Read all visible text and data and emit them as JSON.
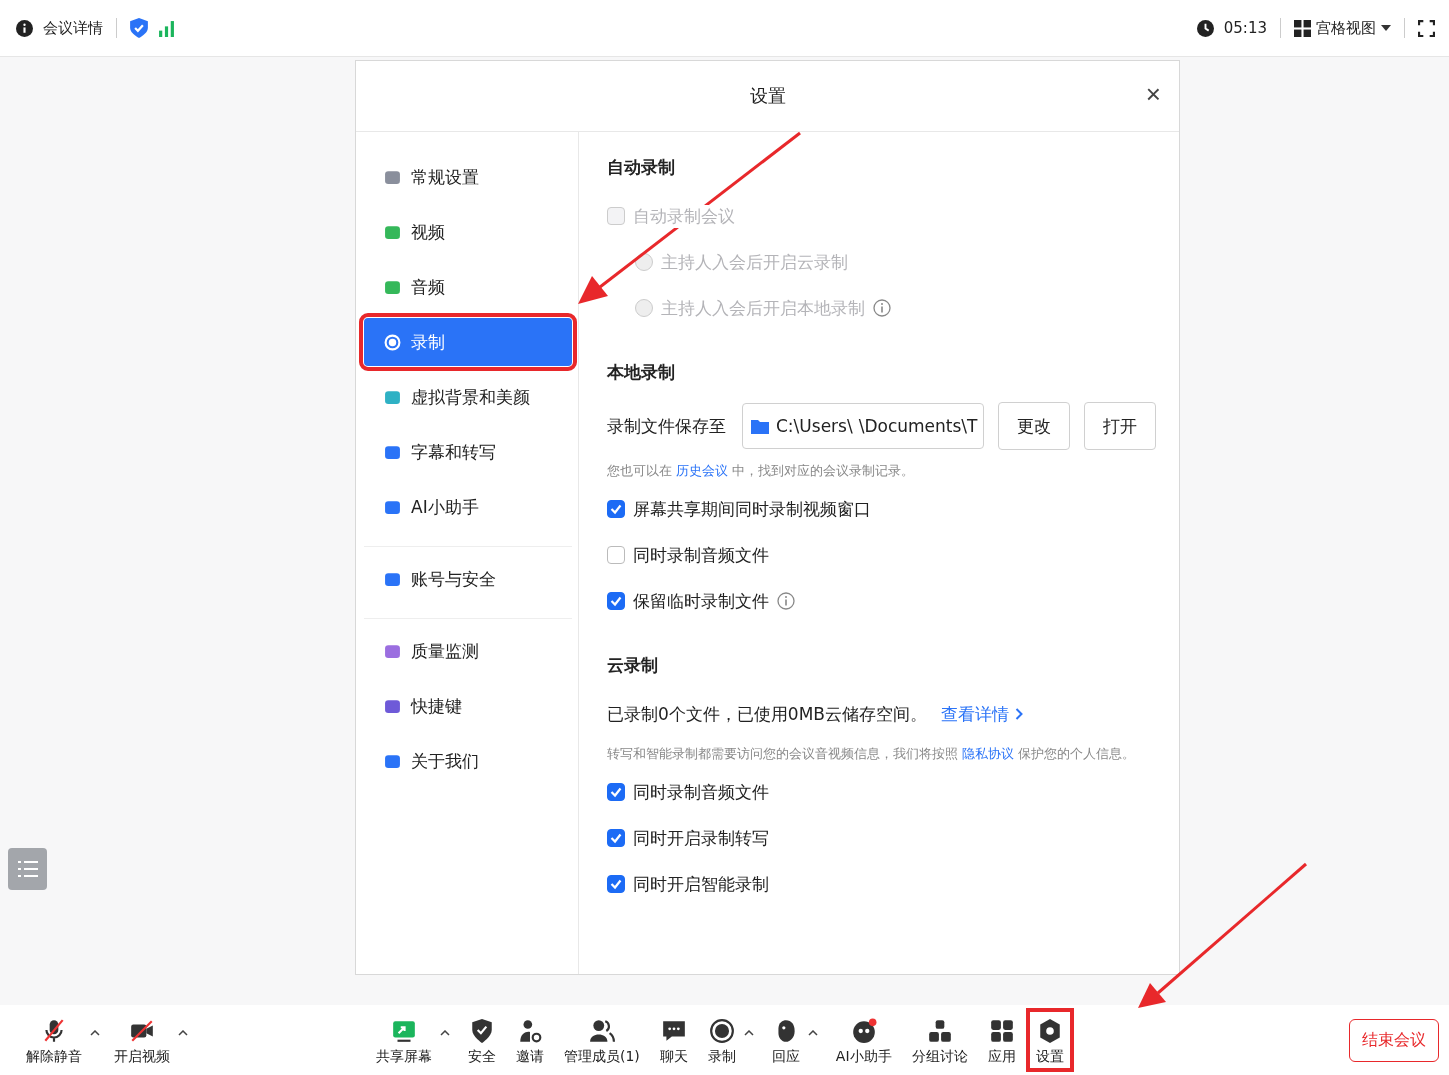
{
  "top_bar": {
    "meeting_info": "会议详情",
    "time": "05:13",
    "view": "宫格视图"
  },
  "dialog": {
    "title": "设置",
    "close": "×",
    "nav_groups": [
      [
        {
          "label": "常规设置",
          "selected": false,
          "highlighted": false
        },
        {
          "label": "视频",
          "selected": false,
          "highlighted": false
        },
        {
          "label": "音频",
          "selected": false,
          "highlighted": false
        },
        {
          "label": "录制",
          "selected": true,
          "highlighted": true
        },
        {
          "label": "虚拟背景和美颜",
          "selected": false,
          "highlighted": false
        },
        {
          "label": "字幕和转写",
          "selected": false,
          "highlighted": false
        },
        {
          "label": "AI小助手",
          "selected": false,
          "highlighted": false
        }
      ],
      [
        {
          "label": "账号与安全",
          "selected": false,
          "highlighted": false
        }
      ],
      [
        {
          "label": "质量监测",
          "selected": false,
          "highlighted": false
        },
        {
          "label": "快捷键",
          "selected": false,
          "highlighted": false
        },
        {
          "label": "关于我们",
          "selected": false,
          "highlighted": false
        }
      ]
    ],
    "sections": [
      {
        "title": "自动录制",
        "items": [
          {
            "kind": "checkbox",
            "label": "自动录制会议",
            "checked": false,
            "disabled": true
          },
          {
            "kind": "radio",
            "label": "主持人入会后开启云录制",
            "selected": false,
            "disabled": true
          },
          {
            "kind": "radio",
            "label": "主持人入会后开启本地录制",
            "selected": false,
            "disabled": true,
            "info": true
          }
        ]
      },
      {
        "title": "本地录制",
        "items": [
          {
            "kind": "path",
            "label": "录制文件保存至",
            "path_start": "C:\\Users\\",
            "path_end": "\\Documents\\T",
            "buttons": [
              "更改",
              "打开"
            ]
          },
          {
            "kind": "note",
            "before": "您也可以在",
            "link": "历史会议",
            "after": "中，找到对应的会议录制记录。"
          },
          {
            "kind": "checkbox",
            "label": "屏幕共享期间同时录制视频窗口",
            "checked": true,
            "disabled": false
          },
          {
            "kind": "checkbox",
            "label": "同时录制音频文件",
            "checked": false,
            "disabled": false
          },
          {
            "kind": "checkbox",
            "label": "保留临时录制文件",
            "checked": true,
            "disabled": false,
            "info": true
          }
        ]
      },
      {
        "title": "云录制",
        "items": [
          {
            "kind": "status",
            "text": "已录制0个文件，已使用0MB云储存空间。",
            "link": "查看详情"
          },
          {
            "kind": "note",
            "before": "转写和智能录制都需要访问您的会议音视频信息，我们将按照",
            "link": "隐私协议",
            "after": "保护您的个人信息。"
          },
          {
            "kind": "checkbox",
            "label": "同时录制音频文件",
            "checked": true,
            "disabled": false
          },
          {
            "kind": "checkbox",
            "label": "同时开启录制转写",
            "checked": true,
            "disabled": false
          },
          {
            "kind": "checkbox",
            "label": "同时开启智能录制",
            "checked": true,
            "disabled": false
          }
        ]
      }
    ]
  },
  "toolbar": {
    "left": [
      {
        "label": "解除静音",
        "caret": true
      },
      {
        "label": "开启视频",
        "caret": true
      }
    ],
    "center": [
      {
        "label": "共享屏幕",
        "caret": true,
        "highlighted": false
      },
      {
        "label": "安全",
        "highlighted": false
      },
      {
        "label": "邀请",
        "highlighted": false
      },
      {
        "label": "管理成员(1)",
        "highlighted": false
      },
      {
        "label": "聊天",
        "highlighted": false
      },
      {
        "label": "录制",
        "caret": true,
        "highlighted": false
      },
      {
        "label": "回应",
        "caret": true,
        "highlighted": false
      },
      {
        "label": "AI小助手",
        "highlighted": false
      },
      {
        "label": "分组讨论",
        "highlighted": false
      },
      {
        "label": "应用",
        "highlighted": false
      },
      {
        "label": "设置",
        "highlighted": true
      }
    ],
    "end": "结束会议"
  }
}
